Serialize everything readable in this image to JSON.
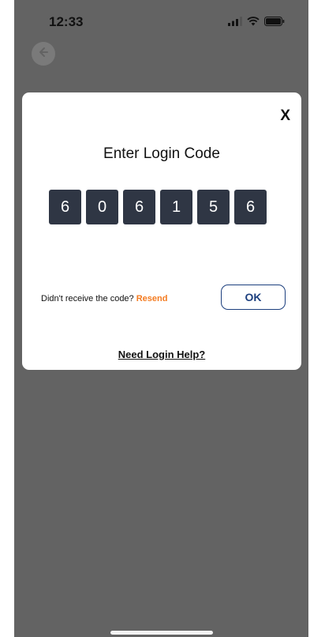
{
  "status_bar": {
    "time": "12:33"
  },
  "modal": {
    "close_label": "X",
    "title": "Enter Login Code",
    "code_digits": [
      "6",
      "0",
      "6",
      "1",
      "5",
      "6"
    ],
    "resend_prompt": "Didn't receive the code?",
    "resend_link": "Resend",
    "ok_label": "OK",
    "help_link": "Need Login Help?"
  },
  "colors": {
    "overlay_background": "#636363",
    "code_box": "#2f3644",
    "resend_accent": "#f47b20",
    "ok_border": "#1c3f7e"
  }
}
